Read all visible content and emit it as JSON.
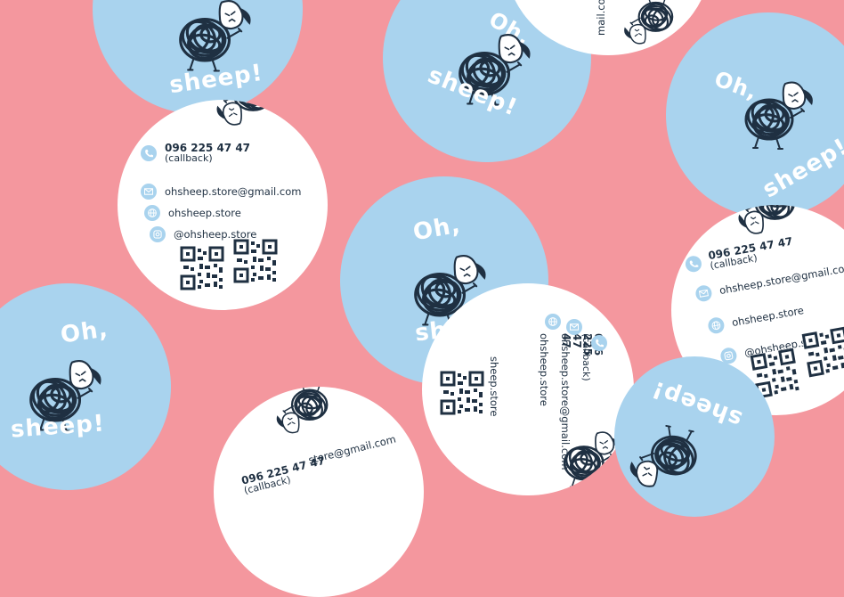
{
  "brand": {
    "line1": "Oh,",
    "line2": "sheep!"
  },
  "contact": {
    "phone": "096 225 47 47",
    "callback": "(callback)",
    "email": "ohsheep.store@gmail.com",
    "website": "ohsheep.store",
    "instagram": "@ohsheep.store"
  },
  "fragments": {
    "top_email_tail": "mail.com",
    "bottom_email_tail": "store@gmail.com",
    "mid_store_tail": "sheep.store"
  },
  "icons": [
    "phone-icon",
    "mail-icon",
    "globe-icon",
    "instagram-icon",
    "qr-code",
    "sheep-illustration"
  ],
  "colors": {
    "background": "#f4979e",
    "blue_sticker": "#a9d3ee",
    "white_sticker": "#ffffff",
    "ink": "#1f3042"
  }
}
